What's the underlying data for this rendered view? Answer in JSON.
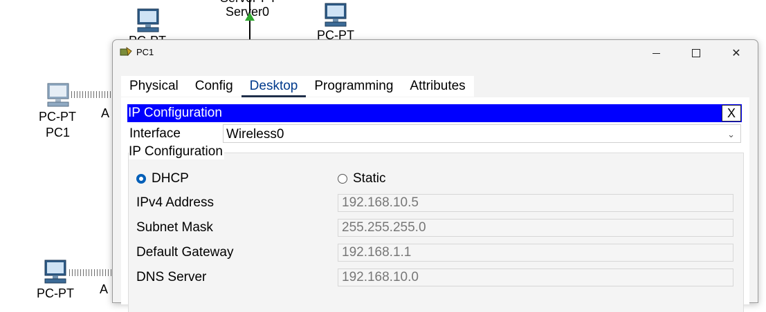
{
  "workspace": {
    "server_label_top": "Server-PT",
    "server_label": "Server0",
    "pc_top_left_label": "PC-PT",
    "pc_top_right_label": "PC-PT",
    "pc1_type": "PC-PT",
    "pc1_name": "PC1",
    "pc1_side_label": "A",
    "pc_bottom_type": "PC-PT",
    "pc_bottom_side_label": "A"
  },
  "window": {
    "title": "PC1",
    "min_label": "",
    "max_label": "",
    "close_label": "✕"
  },
  "tabs": [
    {
      "label": "Physical"
    },
    {
      "label": "Config"
    },
    {
      "label": "Desktop"
    },
    {
      "label": "Programming"
    },
    {
      "label": "Attributes"
    }
  ],
  "active_tab": "Desktop",
  "ip_config": {
    "panel_title": "IP Configuration",
    "close_label": "X",
    "interface_label": "Interface",
    "interface_value": "Wireless0",
    "group_title": "IP Configuration",
    "dhcp_label": "DHCP",
    "static_label": "Static",
    "mode": "DHCP",
    "fields": [
      {
        "label": "IPv4 Address",
        "value": "192.168.10.5"
      },
      {
        "label": "Subnet Mask",
        "value": "255.255.255.0"
      },
      {
        "label": "Default Gateway",
        "value": "192.168.1.1"
      },
      {
        "label": "DNS Server",
        "value": "192.168.10.0"
      }
    ]
  },
  "colors": {
    "title_bar_blue": "#0000ff",
    "radio_accent": "#005fb8",
    "active_tab_underline": "#1f2f4a"
  }
}
